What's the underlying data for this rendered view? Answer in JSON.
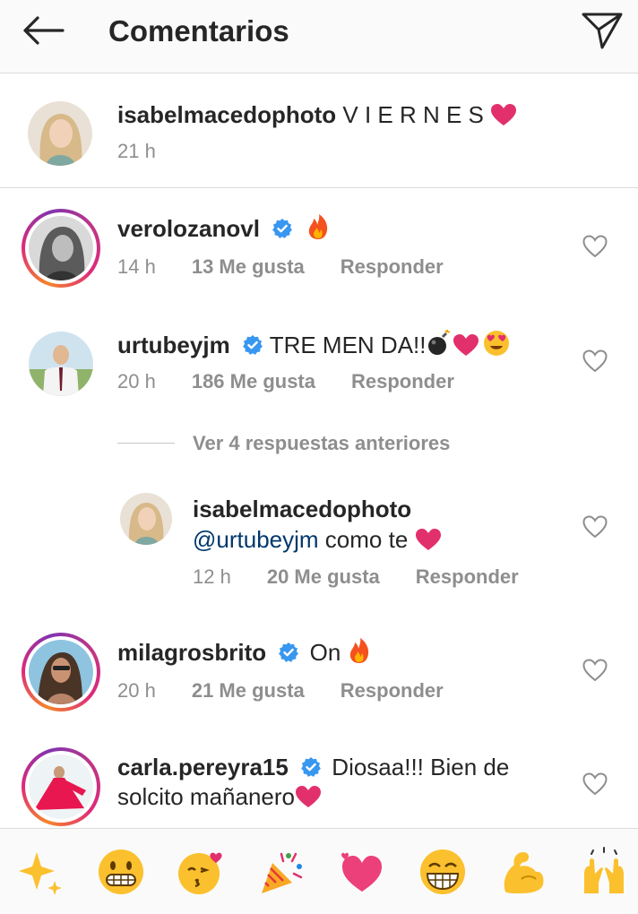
{
  "header": {
    "title": "Comentarios",
    "back_icon": "arrow-left-icon",
    "direct_icon": "paper-plane-icon"
  },
  "caption": {
    "username": "isabelmacedophoto",
    "text": "V I E R N E S",
    "emoji": "heart",
    "time": "21 h"
  },
  "comments": [
    {
      "username": "verolozanovl",
      "verified": true,
      "text": "",
      "emoji": "fire",
      "time": "14 h",
      "likes": "13 Me gusta",
      "reply": "Responder"
    },
    {
      "username": "urtubeyjm",
      "verified": true,
      "text": "TRE MEN DA!!",
      "emoji": "bomb, heart, heart-eyes",
      "time": "20 h",
      "likes": "186 Me gusta",
      "reply": "Responder"
    },
    {
      "username": "milagrosbrito",
      "verified": true,
      "text": "On",
      "emoji": "fire",
      "time": "20 h",
      "likes": "21 Me gusta",
      "reply": "Responder"
    },
    {
      "username": "carla.pereyra15",
      "verified": true,
      "text": "Diosaa!!! Bien de",
      "text2": "solcito mañanero",
      "emoji": "heart"
    }
  ],
  "view_replies": "Ver 4 respuestas anteriores",
  "reply": {
    "username": "isabelmacedophoto",
    "mention": "@urtubeyjm",
    "text": "como te",
    "emoji": "heart",
    "time": "12 h",
    "likes": "20 Me gusta",
    "reply": "Responder"
  },
  "emoji_bar": [
    "sparkles",
    "grinning-face",
    "kissing-face",
    "party-popper",
    "two-hearts",
    "beaming-face",
    "flexed-biceps",
    "raising-hands"
  ],
  "colors": {
    "heart": "#e1306c",
    "verified": "#3897f0",
    "mention": "#00376b",
    "muted": "#8e8e8e"
  }
}
